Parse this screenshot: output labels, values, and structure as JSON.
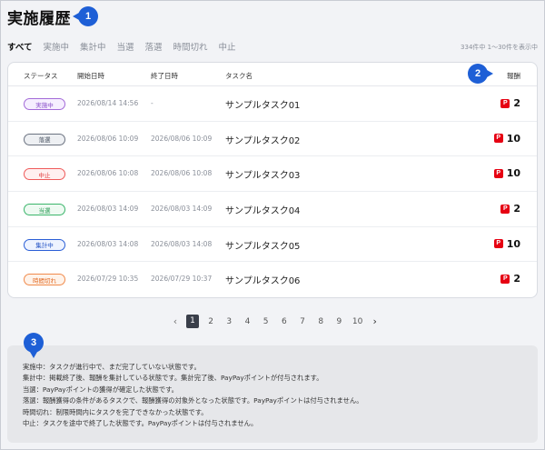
{
  "page": {
    "title": "実施履歴"
  },
  "annotations": [
    "1",
    "2",
    "3"
  ],
  "filters": {
    "tabs": [
      {
        "label": "すべて",
        "active": true
      },
      {
        "label": "実施中",
        "active": false
      },
      {
        "label": "集計中",
        "active": false
      },
      {
        "label": "当選",
        "active": false
      },
      {
        "label": "落選",
        "active": false
      },
      {
        "label": "時間切れ",
        "active": false
      },
      {
        "label": "中止",
        "active": false
      }
    ],
    "count_text": "334件中 1〜30件を表示中"
  },
  "table": {
    "headers": {
      "status": "ステータス",
      "start": "開始日時",
      "end": "終了日時",
      "task": "タスク名",
      "reward": "報酬"
    },
    "rows": [
      {
        "status": "実施中",
        "start": "2026/08/14 14:56",
        "end": "-",
        "task": "サンプルタスク01",
        "reward": "2"
      },
      {
        "status": "落選",
        "start": "2026/08/06 10:09",
        "end": "2026/08/06 10:09",
        "task": "サンプルタスク02",
        "reward": "10"
      },
      {
        "status": "中止",
        "start": "2026/08/06 10:08",
        "end": "2026/08/06 10:08",
        "task": "サンプルタスク03",
        "reward": "10"
      },
      {
        "status": "当選",
        "start": "2026/08/03 14:09",
        "end": "2026/08/03 14:09",
        "task": "サンプルタスク04",
        "reward": "2"
      },
      {
        "status": "集計中",
        "start": "2026/08/03 14:08",
        "end": "2026/08/03 14:08",
        "task": "サンプルタスク05",
        "reward": "10"
      },
      {
        "status": "時間切れ",
        "start": "2026/07/29 10:35",
        "end": "2026/07/29 10:37",
        "task": "サンプルタスク06",
        "reward": "2"
      }
    ],
    "reward_icon": "paypay-icon",
    "reward_icon_glyph": "P"
  },
  "status_colors": {
    "実施中": {
      "border": "#a36ad8",
      "text": "#8a4fc9",
      "bg": "#f6efff"
    },
    "落選": {
      "border": "#6b7280",
      "text": "#4b5563",
      "bg": "#eef0f3"
    },
    "中止": {
      "border": "#ef5a5a",
      "text": "#e03b3b",
      "bg": "#fff0f0"
    },
    "当選": {
      "border": "#3bb56b",
      "text": "#2a9a55",
      "bg": "#eefaf2"
    },
    "集計中": {
      "border": "#2b5fd6",
      "text": "#2050c4",
      "bg": "#eef3ff"
    },
    "時間切れ": {
      "border": "#f08a4b",
      "text": "#e06a25",
      "bg": "#fff3ea"
    }
  },
  "pagination": {
    "prev": "‹",
    "next": "›",
    "pages": [
      "1",
      "2",
      "3",
      "4",
      "5",
      "6",
      "7",
      "8",
      "9",
      "10"
    ],
    "current": "1"
  },
  "notes": [
    "実施中：タスクが進行中で、まだ完了していない状態です。",
    "集計中：掲載終了後、報酬を集計している状態です。集計完了後、PayPayポイントが付与されます。",
    "当選：PayPayポイントの獲得が確定した状態です。",
    "落選：報酬獲得の条件があるタスクで、報酬獲得の対象外となった状態です。PayPayポイントは付与されません。",
    "時間切れ：制限時間内にタスクを完了できなかった状態です。",
    "中止：タスクを途中で終了した状態です。PayPayポイントは付与されません。"
  ]
}
